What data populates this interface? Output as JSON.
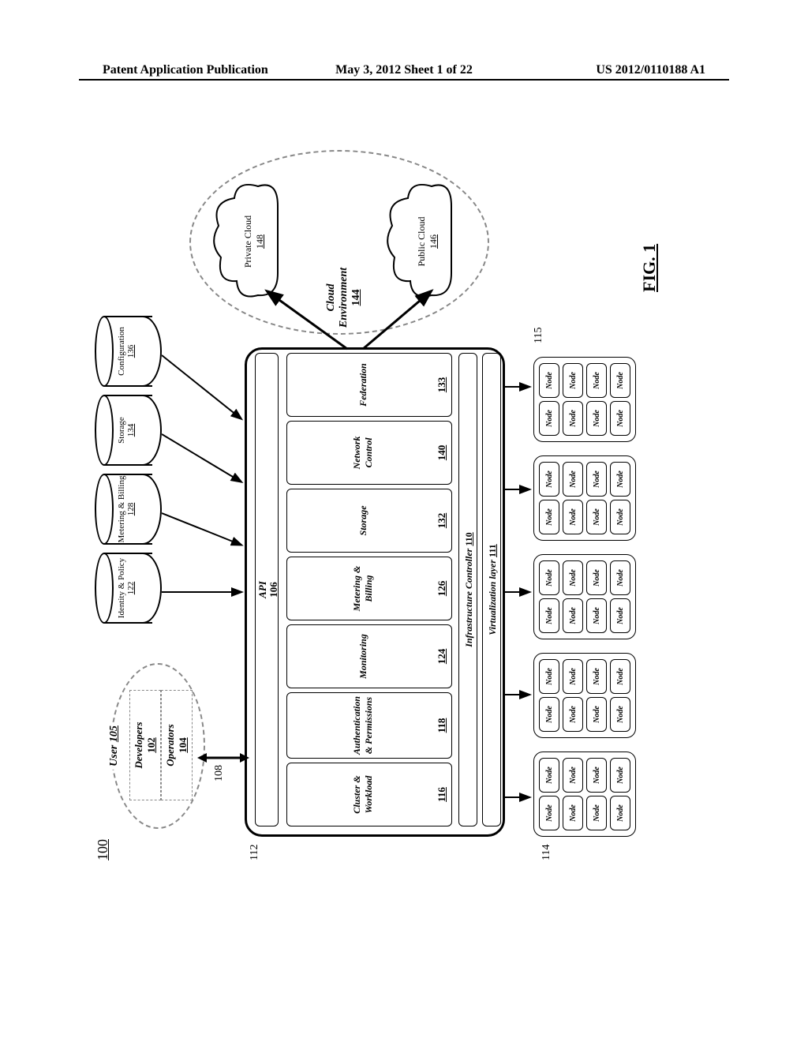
{
  "header": {
    "left": "Patent Application Publication",
    "center": "May 3, 2012  Sheet 1 of 22",
    "right": "US 2012/0110188 A1"
  },
  "figure": {
    "ref_main": "100",
    "label": "FIG. 1",
    "users": {
      "title": "User",
      "title_ref": "105",
      "developers": {
        "label": "Developers",
        "ref": "102"
      },
      "operators": {
        "label": "Operators",
        "ref": "104"
      }
    },
    "databases": [
      {
        "label": "Identity & Policy",
        "ref": "122"
      },
      {
        "label": "Metering & Billing",
        "ref": "128"
      },
      {
        "label": "Storage",
        "ref": "134"
      },
      {
        "label": "Configuration",
        "ref": "136"
      }
    ],
    "arrow_labels": {
      "l108": "108",
      "l112": "112",
      "l114": "114",
      "l115": "115"
    },
    "main_box": {
      "api": {
        "label": "API",
        "ref": "106"
      },
      "modules": [
        {
          "label": "Cluster & Workload",
          "ref": "116"
        },
        {
          "label": "Authentication & Permissions",
          "ref": "118"
        },
        {
          "label": "Monitoring",
          "ref": "124"
        },
        {
          "label": "Metering & Billing",
          "ref": "126"
        },
        {
          "label": "Storage",
          "ref": "132"
        },
        {
          "label": "Network Control",
          "ref": "140"
        },
        {
          "label": "Federation",
          "ref": "133"
        }
      ],
      "infra": {
        "label": "Infrastructure Controller",
        "ref": "110"
      },
      "virt": {
        "label": "Virtualization layer",
        "ref": "111"
      }
    },
    "node_label": "Node",
    "cloud_env": {
      "label": "Cloud Environment",
      "ref": "144",
      "private": {
        "label": "Private Cloud",
        "ref": "148"
      },
      "public": {
        "label": "Public Cloud",
        "ref": "146"
      }
    }
  }
}
